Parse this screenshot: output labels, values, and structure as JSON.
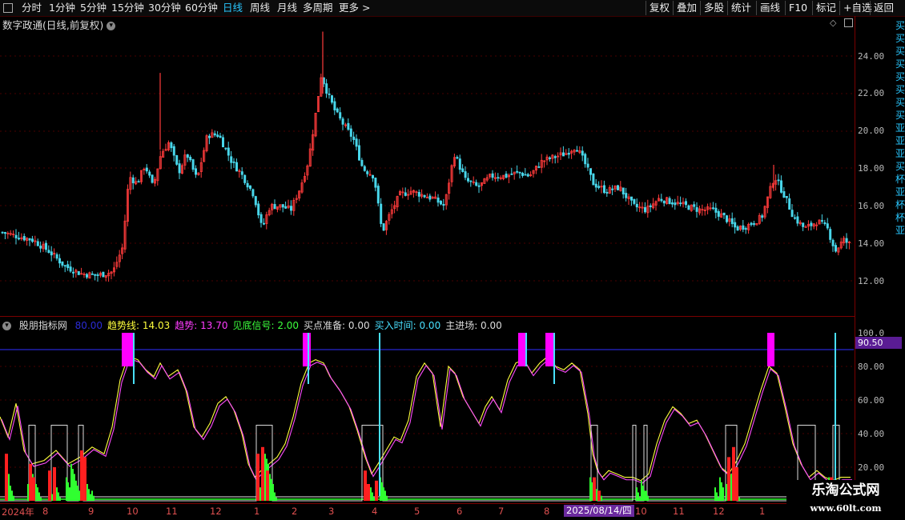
{
  "toolbar": {
    "periods": [
      "分时",
      "1分钟",
      "5分钟",
      "15分钟",
      "30分钟",
      "60分钟",
      "日线",
      "周线",
      "月线",
      "多周期",
      "更多"
    ],
    "active": "日线",
    "more_arrow": ">",
    "right_buttons": [
      "复权",
      "叠加",
      "多股",
      "统计",
      "画线",
      "F10",
      "标记",
      "+自选",
      "返回"
    ]
  },
  "chart_title": "数字政通(日线,前复权)",
  "price_axis": [
    "24.00",
    "22.00",
    "20.00",
    "18.00",
    "16.00",
    "14.00",
    "12.00"
  ],
  "indicator": {
    "name": "股朋指标网",
    "items": [
      {
        "text": "80.00",
        "color": "#2b2bd6"
      },
      {
        "text": "趋势线: 14.03",
        "color": "#ffff3c"
      },
      {
        "text": "趋势: 13.70",
        "color": "#ff3cff"
      },
      {
        "text": "见底信号: 2.00",
        "color": "#3cff3c"
      },
      {
        "text": "买点准备: 0.00",
        "color": "#dddddd"
      },
      {
        "text": "买入时间: 0.00",
        "color": "#48e0ff"
      },
      {
        "text": "主进场: 0.00",
        "color": "#dddddd"
      }
    ],
    "axis": [
      "100.0",
      "80.00",
      "60.00",
      "40.00",
      "20.00"
    ],
    "level_value": "90.50"
  },
  "x_axis": {
    "labels": [
      "2024年",
      "8",
      "9",
      "10",
      "11",
      "12",
      "1",
      "2",
      "3",
      "4",
      "5",
      "6",
      "7",
      "8",
      "10",
      "11",
      "12",
      "1"
    ],
    "cursor_date": "2025/08/14/四"
  },
  "watermark": {
    "line1": "乐淘公式网",
    "line2": "www.60lt.com"
  },
  "right_panel_text": "买买买买买买买买亚亚亚买杯亚杯杯亚"
}
